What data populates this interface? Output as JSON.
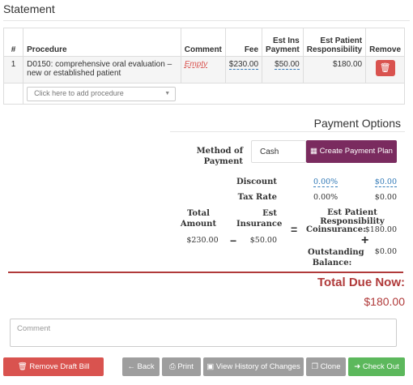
{
  "statement": {
    "title": "Statement"
  },
  "table": {
    "headers": [
      "#",
      "Procedure",
      "Comment",
      "Fee",
      "Est Ins Payment",
      "Est Patient Responsibility",
      "Remove"
    ],
    "rows": [
      {
        "num": "1",
        "procedure": "D0150: comprehensive oral evaluation – new or established patient",
        "comment": "Empty",
        "fee": "$230.00",
        "ins": "$50.00",
        "patient": "$180.00"
      }
    ],
    "add_placeholder": "Click here to add procedure"
  },
  "payment": {
    "title": "Payment Options",
    "method_label": "Method of Payment",
    "method_value": "Cash",
    "create_plan": "Create Payment Plan",
    "discount_label": "Discount",
    "discount_pct": "0.00%",
    "discount_amt": "$0.00",
    "tax_label": "Tax Rate",
    "tax_pct": "0.00%",
    "tax_amt": "$0.00",
    "total_amount_label": "Total Amount",
    "total_amount": "$230.00",
    "est_ins_label": "Est Insurance",
    "est_ins": "$50.00",
    "epr_label": "Est Patient Responsibility",
    "coins_label": "Coinsurance:",
    "coins": "$180.00",
    "outstanding_label": "Outstanding Balance:",
    "outstanding": "$0.00",
    "total_due_label": "Total Due Now:",
    "total_due": "$180.00"
  },
  "comment": {
    "placeholder": "Comment"
  },
  "buttons": {
    "remove_draft": "Remove Draft Bill",
    "back": "Back",
    "print": "Print",
    "history": "View History of Changes",
    "clone": "Clone",
    "checkout": "Check Out"
  },
  "colors": {
    "danger": "#d9534f",
    "purple": "#7a2b5f",
    "success": "#5cb85c",
    "grey": "#9e9e9e",
    "total": "#b03a3a"
  }
}
